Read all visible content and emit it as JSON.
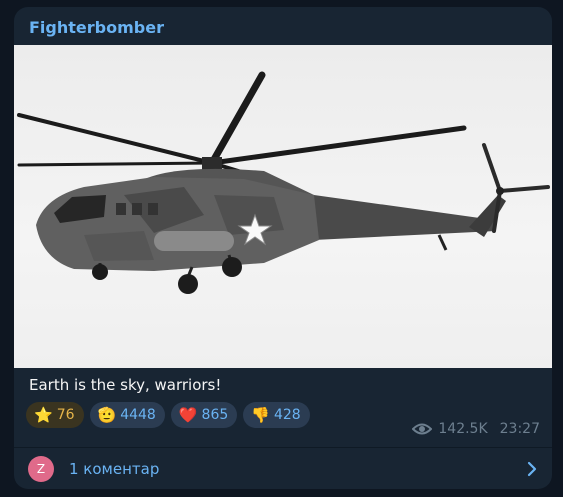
{
  "post": {
    "channel_name": "Fighterbomber",
    "caption": "Earth is the sky, warriors!",
    "reactions": [
      {
        "icon": "star-icon",
        "emoji": "⭐",
        "count": "76"
      },
      {
        "icon": "salute-hand-icon",
        "emoji": "🫡",
        "count": "4448"
      },
      {
        "icon": "red-heart-icon",
        "emoji": "❤️",
        "count": "865"
      },
      {
        "icon": "thumbs-down-icon",
        "emoji": "👎",
        "count": "428"
      }
    ],
    "views": "142.5K",
    "time": "23:27",
    "comments": {
      "avatar_letter": "Z",
      "label": "1 коментар"
    }
  },
  "colors": {
    "background": "#0e1621",
    "bubble": "#182533",
    "accent": "#6ab3f3",
    "muted": "#6d7f8f"
  }
}
